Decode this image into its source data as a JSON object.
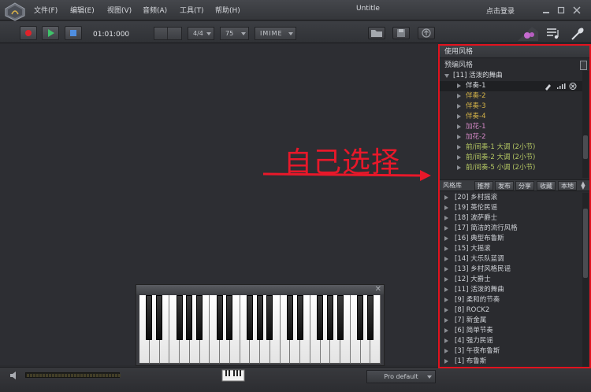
{
  "window": {
    "title": "Untitle",
    "login": "点击登录",
    "menu": [
      "文件(F)",
      "编辑(E)",
      "视图(V)",
      "音频(A)",
      "工具(T)",
      "帮助(H)"
    ]
  },
  "toolbar": {
    "time": "01:01:000",
    "time_signature": "4/4",
    "tempo": "75",
    "input_method": "IMIME"
  },
  "annotation": {
    "text": "自己选择",
    "color": "#e8182a"
  },
  "status": {
    "preset": "Pro default"
  },
  "panel": {
    "title": "使用风格",
    "preset_header": "预编风格",
    "preset_tree": [
      {
        "label": "[11] 活泼的舞曲",
        "level": 0,
        "expanded": true,
        "color": "white"
      },
      {
        "label": "伴奏-1",
        "level": 1,
        "color": "white",
        "selected": true
      },
      {
        "label": "伴奏-2",
        "level": 1,
        "color": "yellow"
      },
      {
        "label": "伴奏-3",
        "level": 1,
        "color": "yellow"
      },
      {
        "label": "伴奏-4",
        "level": 1,
        "color": "yellow"
      },
      {
        "label": "加花-1",
        "level": 1,
        "color": "pink"
      },
      {
        "label": "加花-2",
        "level": 1,
        "color": "pink"
      },
      {
        "label": "前/间奏-1 大调 (2小节)",
        "level": 1,
        "color": "green"
      },
      {
        "label": "前/间奏-2 大调 (2小节)",
        "level": 1,
        "color": "green"
      },
      {
        "label": "前/间奏-5 小调 (2小节)",
        "level": 1,
        "color": "green"
      }
    ],
    "library_title": "风格库",
    "library_tabs": [
      "推荐",
      "发布",
      "分享",
      "收藏",
      "本地"
    ],
    "library_items": [
      "[20] 乡村摇滚",
      "[19] 英伦民谣",
      "[18] 波萨爵士",
      "[17] 简洁的流行风格",
      "[16] 典型布鲁斯",
      "[15] 大摇滚",
      "[14] 大乐队蓝调",
      "[13] 乡村风格民谣",
      "[12] 大爵士",
      "[11] 活泼的舞曲",
      "[9] 柔和的节奏",
      "[8] ROCK2",
      "[7] 新金属",
      "[6] 简单节奏",
      "[4] 强力民谣",
      "[3] 午夜布鲁斯",
      "[1] 布鲁斯"
    ]
  }
}
